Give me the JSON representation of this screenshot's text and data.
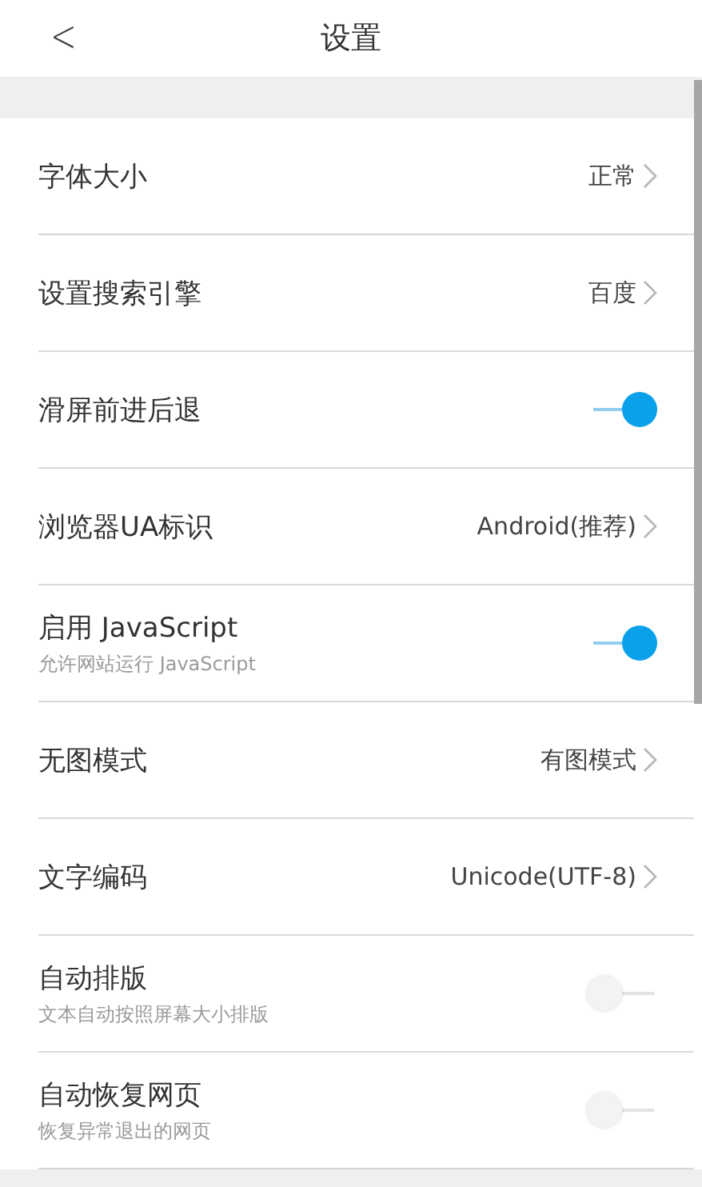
{
  "header": {
    "back": "<",
    "title": "设置"
  },
  "settings": [
    {
      "kind": "value",
      "label": "字体大小",
      "value": "正常"
    },
    {
      "kind": "value",
      "label": "设置搜索引擎",
      "value": "百度"
    },
    {
      "kind": "toggle",
      "label": "滑屏前进后退",
      "on": true
    },
    {
      "kind": "value",
      "label": "浏览器UA标识",
      "value": "Android(推荐)"
    },
    {
      "kind": "toggle",
      "label": "启用 JavaScript",
      "subtitle": "允许网站运行 JavaScript",
      "on": true
    },
    {
      "kind": "value",
      "label": "无图模式",
      "value": "有图模式"
    },
    {
      "kind": "value",
      "label": "文字编码",
      "value": "Unicode(UTF-8)"
    },
    {
      "kind": "toggle",
      "label": "自动排版",
      "subtitle": "文本自动按照屏幕大小排版",
      "on": false
    },
    {
      "kind": "toggle",
      "label": "自动恢复网页",
      "subtitle": "恢复异常退出的网页",
      "on": false
    }
  ]
}
